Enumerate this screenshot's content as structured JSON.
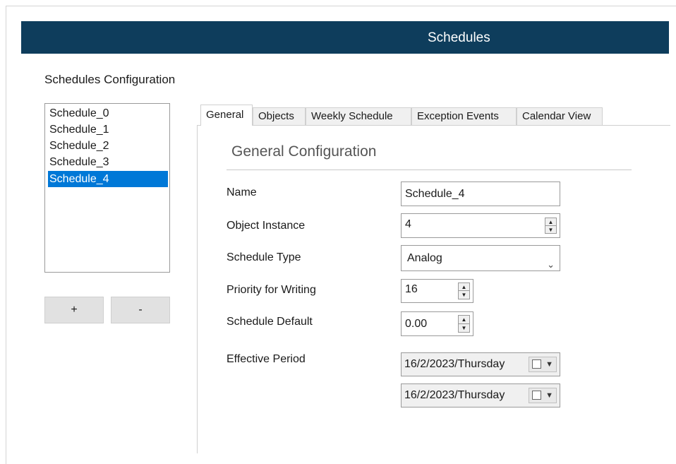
{
  "window": {
    "title": "Schedules"
  },
  "section_title": "Schedules Configuration",
  "schedule_list": {
    "items": [
      "Schedule_0",
      "Schedule_1",
      "Schedule_2",
      "Schedule_3",
      "Schedule_4"
    ],
    "selected": "Schedule_4"
  },
  "buttons": {
    "add_label": "+",
    "remove_label": "-"
  },
  "tabs": [
    {
      "label": "General",
      "active": true
    },
    {
      "label": "Objects",
      "active": false
    },
    {
      "label": "Weekly Schedule",
      "active": false
    },
    {
      "label": "Exception Events",
      "active": false
    },
    {
      "label": "Calendar View",
      "active": false
    }
  ],
  "general": {
    "heading": "General Configuration",
    "name": {
      "label": "Name",
      "value": "Schedule_4"
    },
    "object_instance": {
      "label": "Object Instance",
      "value": "4"
    },
    "schedule_type": {
      "label": "Schedule Type",
      "value": "Analog"
    },
    "priority": {
      "label": "Priority for Writing",
      "value": "16"
    },
    "schedule_default": {
      "label": "Schedule Default",
      "value": "0.00"
    },
    "effective_period": {
      "label": "Effective Period",
      "start": "16/2/2023/Thursday",
      "end": "16/2/2023/Thursday"
    }
  },
  "colors": {
    "titlebar": "#0e3d5c",
    "selection": "#0078d7"
  }
}
